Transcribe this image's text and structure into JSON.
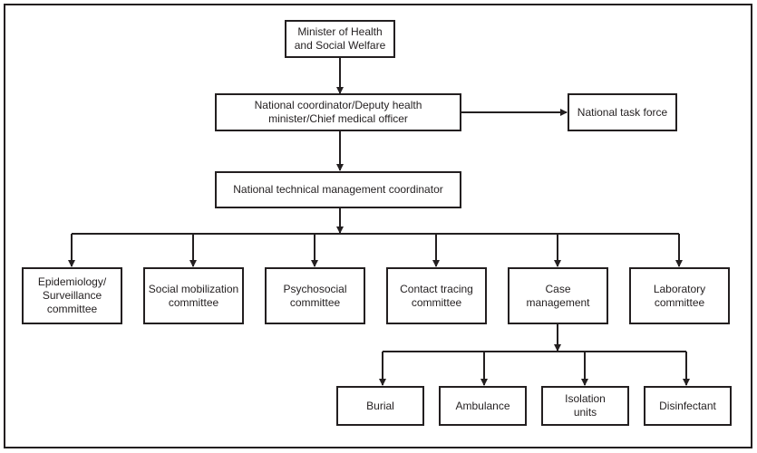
{
  "diagram": {
    "nodes": {
      "minister": "Minister of Health\nand Social Welfare",
      "coordinator": "National coordinator/Deputy health\nminister/Chief medical officer",
      "task_force": "National task force",
      "technical": "National technical management coordinator",
      "epi": "Epidemiology/\nSurveillance\ncommittee",
      "social": "Social mobilization\ncommittee",
      "psycho": "Psychosocial\ncommittee",
      "contact": "Contact tracing\ncommittee",
      "case": "Case\nmanagement",
      "lab": "Laboratory\ncommittee",
      "burial": "Burial",
      "ambulance": "Ambulance",
      "isolation": "Isolation\nunits",
      "disinfectant": "Disinfectant"
    },
    "edges": [
      [
        "minister",
        "coordinator"
      ],
      [
        "coordinator",
        "task_force"
      ],
      [
        "coordinator",
        "technical"
      ],
      [
        "technical",
        "epi"
      ],
      [
        "technical",
        "social"
      ],
      [
        "technical",
        "psycho"
      ],
      [
        "technical",
        "contact"
      ],
      [
        "technical",
        "case"
      ],
      [
        "technical",
        "lab"
      ],
      [
        "case",
        "burial"
      ],
      [
        "case",
        "ambulance"
      ],
      [
        "case",
        "isolation"
      ],
      [
        "case",
        "disinfectant"
      ]
    ]
  }
}
